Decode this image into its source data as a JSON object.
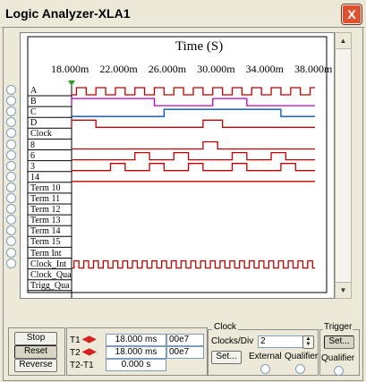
{
  "window": {
    "title": "Logic Analyzer-XLA1",
    "close_label": "X"
  },
  "plot": {
    "axis_title": "Time (S)",
    "ticks": [
      "18.000m",
      "22.000m",
      "26.000m",
      "30.000m",
      "34.000m",
      "38.000m"
    ],
    "channels": [
      "A",
      "B",
      "C",
      "D",
      "Clock",
      "8",
      "6",
      "3",
      "14",
      "Term 10",
      "Term 11",
      "Term 12",
      "Term 13",
      "Term 14",
      "Term 15",
      "Term Int",
      "Clock_Int",
      "Clock_Qua",
      "Trigg_Qua"
    ]
  },
  "chart_data": {
    "type": "timing",
    "x_label": "Time (S)",
    "x_ticks": [
      "18.000m",
      "22.000m",
      "26.000m",
      "30.000m",
      "34.000m",
      "38.000m"
    ],
    "x_range_ms": [
      18,
      38
    ],
    "signals": [
      {
        "name": "A",
        "color": "#c00000",
        "type": "square",
        "period": 1.6,
        "phase": 0.4
      },
      {
        "name": "B",
        "color": "#c000c0",
        "edges": [
          18.0,
          24.8,
          29.6,
          32.4
        ]
      },
      {
        "name": "C",
        "color": "#0050d0",
        "edges": [
          25.6,
          35.2
        ]
      },
      {
        "name": "D",
        "color": "#c00000",
        "edges": [
          18.0,
          20.0,
          28.8,
          30.4
        ]
      },
      {
        "name": "8",
        "color": "#c00000",
        "edges": [
          28.8,
          30.0
        ]
      },
      {
        "name": "6",
        "color": "#c00000",
        "edges": [
          23.2,
          24.4,
          26.4,
          27.6,
          31.2,
          32.4,
          34.4,
          35.6
        ]
      },
      {
        "name": "3",
        "color": "#c00000",
        "edges": [
          21.2,
          22.4,
          24.4,
          25.6,
          27.6,
          28.8,
          31.2,
          32.4,
          35.2,
          36.4
        ]
      },
      {
        "name": "14",
        "color": "#c00000",
        "edges": []
      },
      {
        "name": "Clock_Int",
        "color": "#c00000",
        "type": "square",
        "period": 0.8,
        "phase": 0.2
      }
    ]
  },
  "controls": {
    "stop": "Stop",
    "reset": "Reset",
    "reverse": "Reverse",
    "t1": "T1",
    "t2": "T2",
    "t2t1": "T2-T1",
    "t1_value": "18.000 ms",
    "t2_value": "18.000 ms",
    "t2t1_value": "0.000 s",
    "t1_hex": "00e7",
    "t2_hex": "00e7",
    "clock_title": "Clock",
    "clocks_div_label": "Clocks/Div",
    "clocks_div_value": "2",
    "set_label": "Set...",
    "external": "External",
    "qualifier": "Qualifier",
    "trigger_title": "Trigger",
    "trigger_set": "Set...",
    "trigger_qualifier": "Qualifier"
  }
}
